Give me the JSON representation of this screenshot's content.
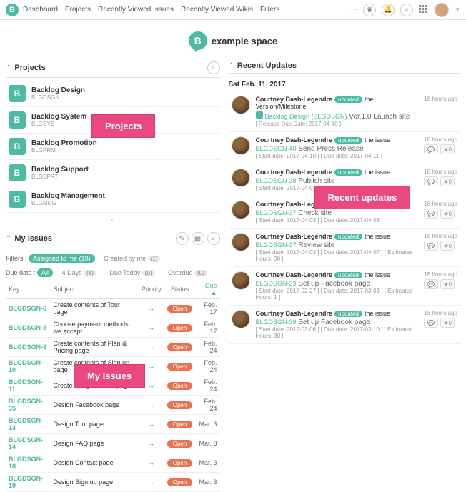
{
  "nav": [
    "Dashboard",
    "Projects",
    "Recently Viewed Issues",
    "Recently Viewed Wikis",
    "Filters"
  ],
  "space_name": "example space",
  "panels": {
    "projects": "Projects",
    "my_issues": "My Issues",
    "recent": "Recent Updates"
  },
  "projects": [
    {
      "name": "Backlog Design",
      "key": "BLGDSGN"
    },
    {
      "name": "Backlog System",
      "key": "BLGSYS"
    },
    {
      "name": "Backlog Promotion",
      "key": "BLGPRM"
    },
    {
      "name": "Backlog Support",
      "key": "BLGSPRT"
    },
    {
      "name": "Backlog Management",
      "key": "BLGMNG"
    }
  ],
  "filters": {
    "label": "Filters :",
    "assigned": "Assigned to me",
    "assigned_count": "(19)",
    "created": "Created by me",
    "created_count": "(1)",
    "duedate_label": "Due date :",
    "all": "All",
    "days4": "4 Days",
    "days4_count": "(4)",
    "duetoday": "Due Today",
    "duetoday_count": "(0)",
    "overdue": "Overdue",
    "overdue_count": "(0)"
  },
  "issue_headers": {
    "key": "Key",
    "subject": "Subject",
    "priority": "Priority",
    "status": "Status",
    "due": "Due ▲"
  },
  "issues": [
    {
      "key": "BLGDSGN-6",
      "subject": "Create contents of Tour page",
      "status": "Open",
      "due": "Feb. 17"
    },
    {
      "key": "BLGDSGN-8",
      "subject": "Choose payment methods we accept",
      "status": "Open",
      "due": "Feb. 17"
    },
    {
      "key": "BLGDSGN-9",
      "subject": "Create contents of Plan & Pricing page",
      "status": "Open",
      "due": "Feb. 24"
    },
    {
      "key": "BLGDSGN-10",
      "subject": "Create contents of Sign up page",
      "status": "Open",
      "due": "Feb. 24"
    },
    {
      "key": "BLGDSGN-11",
      "subject": "Create design of Tour page",
      "status": "Open",
      "due": "Feb. 24"
    },
    {
      "key": "BLGDSGN-35",
      "subject": "Design Facebook page",
      "status": "Open",
      "due": "Feb. 24"
    },
    {
      "key": "BLGDSGN-13",
      "subject": "Design Tour page",
      "status": "Open",
      "due": "Mar. 3"
    },
    {
      "key": "BLGDSGN-14",
      "subject": "Design FAQ page",
      "status": "Open",
      "due": "Mar. 3"
    },
    {
      "key": "BLGDSGN-18",
      "subject": "Design Contact page",
      "status": "Open",
      "due": "Mar. 3"
    },
    {
      "key": "BLGDSGN-19",
      "subject": "Design Sign up page",
      "status": "Open",
      "due": "Mar. 3"
    }
  ],
  "updates_date": "Sat Feb. 11, 2017",
  "updates": [
    {
      "user": "Courtney Dash-Legendre",
      "action": "the Version/Milestone",
      "ref": "Backlog Design (BLGDSGN)",
      "line2": "Ver.1.0 Launch site",
      "meta": "[ Release Due Date: 2017-04-10 ]",
      "time": "18 hours ago",
      "icon": true
    },
    {
      "user": "Courtney Dash-Legendre",
      "action": "the issue",
      "ref": "BLGDSGN-40",
      "line2": "Send Press Release",
      "meta": "[ Start date: 2017-04-10 ] [ Due date: 2017-04-11 ]",
      "time": "18 hours ago"
    },
    {
      "user": "Courtney Dash-Legendre",
      "action": "the issue",
      "ref": "BLGDSGN-38",
      "line2": "Publish site",
      "meta": "[ Start date: 2017-04-07 ]",
      "time": "18 hours ago"
    },
    {
      "user": "Courtney Dash-Legendre",
      "action": "the issue",
      "ref": "BLGDSGN-37",
      "line2": "Check site",
      "meta": "[ Start date: 2017-04-03 ] [ Due date: 2017-04-06 ]",
      "time": "18 hours ago"
    },
    {
      "user": "Courtney Dash-Legendre",
      "action": "the issue",
      "ref": "BLGDSGN-37",
      "line2": "Review site",
      "meta": "[ Start date: 2017-04-02 ] [ Due date: 2017-04-07 ] [ Estimated Hours: 30 ]",
      "time": "18 hours ago"
    },
    {
      "user": "Courtney Dash-Legendre",
      "action": "the issue",
      "ref": "BLGDSGN-39",
      "line2": "Set up Facebook page",
      "meta": "[ Start date: 2017-02-27 ] [ Due date: 2017-03-03 ] [ Estimated Hours: 1 ]",
      "time": "18 hours ago"
    },
    {
      "user": "Courtney Dash-Legendre",
      "action": "the issue",
      "ref": "BLGDSGN-39",
      "line2": "Set up Facebook page",
      "meta": "[ Start date: 2017-03-06 ] [ Due date: 2017-03-10 ] [ Estimated Hours: 30 ]",
      "time": "18 hours ago"
    }
  ],
  "annotations": {
    "projects": "Projects",
    "my_issues": "My Issues",
    "recent": "Recent updates"
  },
  "badge_updated": "updated"
}
